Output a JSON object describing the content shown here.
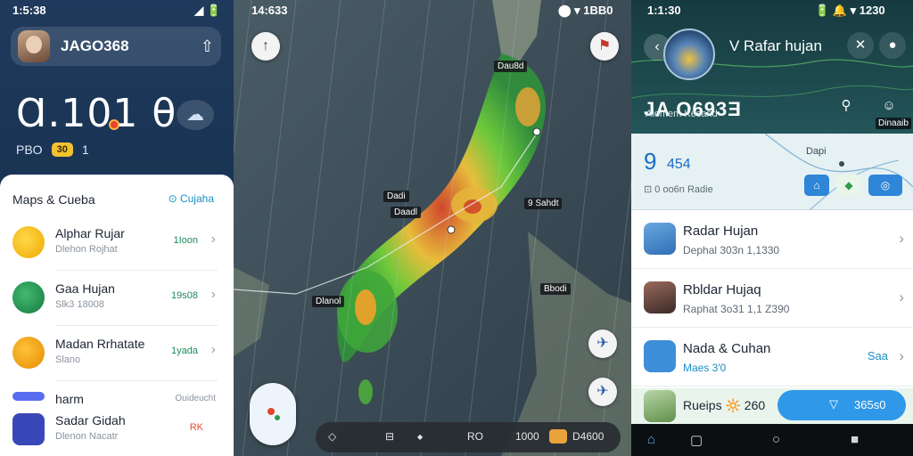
{
  "panel1": {
    "status_time": "1:5:38",
    "status_right": "◢ 🔋",
    "username": "JAGO368",
    "big_value": "Ɑ.101 θ",
    "sub_left": "PBO",
    "sub_badge": "30",
    "sub_right": "1",
    "section_title": "Maps & Cueba",
    "section_link": "⊙ Cujaha",
    "items": [
      {
        "title": "Alphar Rujar",
        "subtitle": "Dlehon Rojhat",
        "value": "1Ioon",
        "color": "#f5b400"
      },
      {
        "title": "Gaa Hujan",
        "subtitle": "Slk3 18008",
        "value": "19s08",
        "color": "#1f8f4f"
      },
      {
        "title": "Madan Rrhatate",
        "subtitle": "Slano",
        "value": "1yada",
        "color": "#f29d12"
      },
      {
        "title": "harm",
        "subtitle": "",
        "value": "Ouideucht",
        "color": "#5a6df0"
      },
      {
        "title": "Sadar Gidah",
        "subtitle": "Dlenon Nacatr",
        "value": "RK",
        "color": "#3948b8"
      }
    ]
  },
  "panel2": {
    "status_time": "14:633",
    "status_right": "⬤ ▾ 1BB0",
    "labels": [
      "Dau8d",
      "Dadi",
      "Daadl",
      "9 Sahdt",
      "Bbodi",
      "Dlanol"
    ],
    "bottom": {
      "shield": "◇",
      "gallery": "⊟",
      "dot": "◆",
      "label_a": "RO",
      "label_b": "1000",
      "label_c": "D4600"
    }
  },
  "panel3": {
    "status_time": "1:1:30",
    "status_right": "🔋 🔔 ▾ 1230",
    "title": "V Rafar hujan",
    "big": "JA O693Ǝ",
    "sub": "Alemem Kesand",
    "tag": "Dinaaib",
    "map_value": "9",
    "map_value2": "454",
    "map_label": "⊡ 0 oo6n Radie",
    "map_place": "Dapi",
    "rows": [
      {
        "title": "Radar Hujan",
        "subtitle": "Dephal 303n 1,1330",
        "value": "",
        "color": "#2f6fb5"
      },
      {
        "title": "Rbldar Hujaq",
        "subtitle": "Raphat 3o31 1,1 Z390",
        "value": "",
        "color": "#7a4a3a"
      },
      {
        "title": "Nada & Cuhan",
        "subtitle": "Maes 3'0",
        "value": "Saa",
        "color": "#3c8fd8"
      }
    ],
    "promo": "Rueips 🔆 260",
    "promo_pill": "365s0"
  }
}
